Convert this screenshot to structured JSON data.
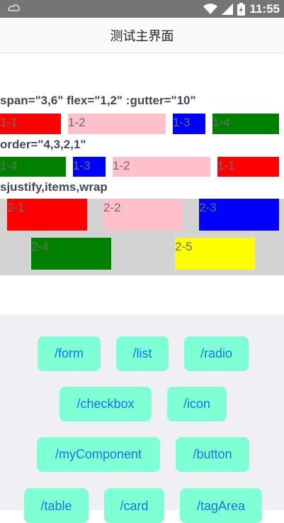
{
  "status_bar": {
    "time": "11:55",
    "icons": [
      "app-icon",
      "wifi-icon",
      "signal-icon",
      "battery-icon"
    ]
  },
  "nav": {
    "title": "测试主界面"
  },
  "section1": {
    "heading": "span=\"3,6\" flex=\"1,2\" :gutter=\"10\"",
    "items": [
      "1-1",
      "1-2",
      "1-3",
      "1-4"
    ]
  },
  "section2": {
    "heading": "order=\"4,3,2,1\"",
    "items": [
      "1-4",
      "1-3",
      "1-2",
      "1-1"
    ]
  },
  "section3": {
    "heading": "sjustify,items,wrap",
    "items": [
      "2-1",
      "2-2",
      "2-3",
      "2-4",
      "2-5"
    ]
  },
  "buttons": [
    "/form",
    "/list",
    "/radio",
    "/checkbox",
    "/icon",
    "/myComponent",
    "/button",
    "/table",
    "/card",
    "/tagArea"
  ],
  "colors": {
    "red": "#ff0000",
    "pink": "#ffc0cb",
    "blue": "#0000ff",
    "green": "#008000",
    "yellow": "#ffff00",
    "button_bg": "#7fffd4",
    "button_text": "#1a73e8"
  }
}
